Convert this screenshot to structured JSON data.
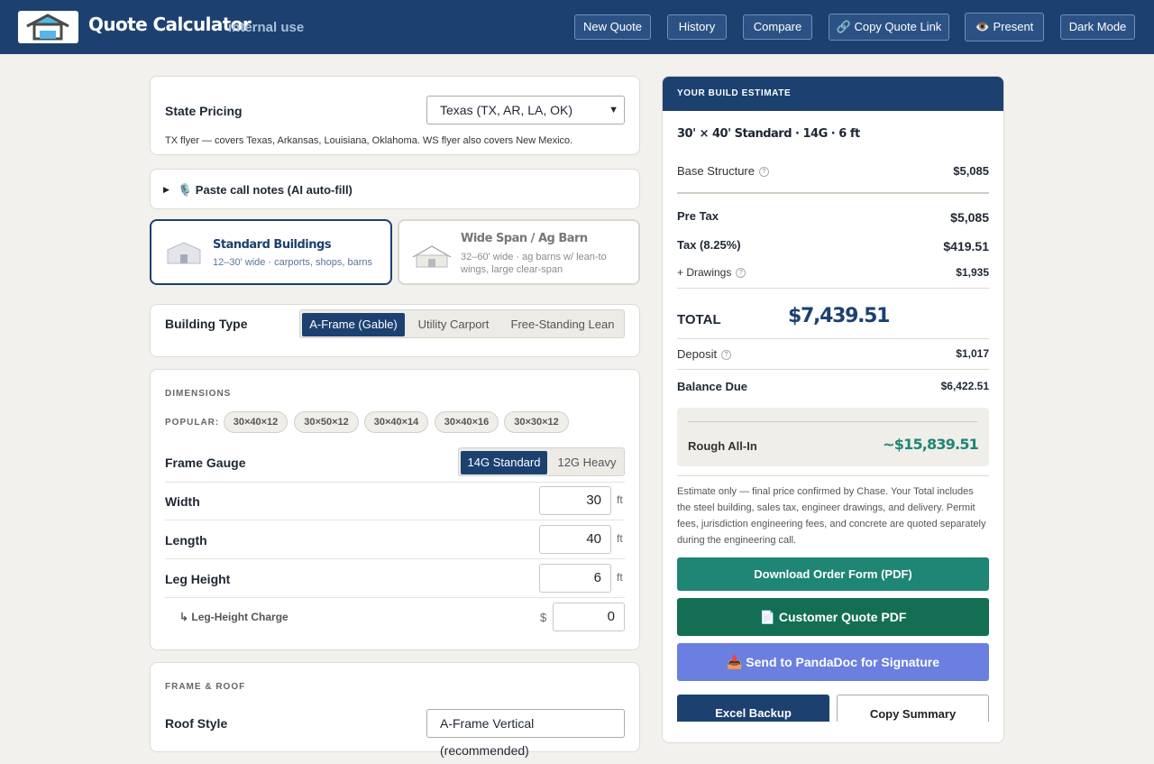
{
  "header": {
    "title": "Quote Calculator",
    "subtitle": "internal use",
    "buttons": {
      "new_quote": "New Quote",
      "history": "History",
      "compare": "Compare",
      "copy_link": "🔗 Copy Quote Link",
      "present": "👁️ Present",
      "dark_mode": "Dark Mode"
    }
  },
  "state_pricing": {
    "label": "State Pricing",
    "selected": "Texas (TX, AR, LA, OK)",
    "note": "TX flyer — covers Texas, Arkansas, Louisiana, Oklahoma. WS flyer also covers New Mexico."
  },
  "call_notes": {
    "label": "🎙️ Paste call notes (AI auto-fill)",
    "arrow": "▶"
  },
  "categories": [
    {
      "title": "Standard Buildings",
      "desc": "12–30' wide · carports, shops, barns",
      "selected": true
    },
    {
      "title": "Wide Span / Ag Barn",
      "desc": "32–60' wide · ag barns w/ lean-to wings, large clear-span",
      "selected": false
    }
  ],
  "building_type": {
    "label": "Building Type",
    "options": [
      "A-Frame (Gable)",
      "Utility Carport",
      "Free-Standing Lean"
    ],
    "selected": "A-Frame (Gable)"
  },
  "dimensions": {
    "section_title": "DIMENSIONS",
    "popular_label": "POPULAR:",
    "popular": [
      "30×40×12",
      "30×50×12",
      "30×40×14",
      "30×40×16",
      "30×30×12"
    ],
    "frame_gauge": {
      "label": "Frame Gauge",
      "options": [
        "14G Standard",
        "12G Heavy"
      ],
      "selected": "14G Standard"
    },
    "width": {
      "label": "Width",
      "value": "30",
      "unit": "ft"
    },
    "length": {
      "label": "Length",
      "value": "40",
      "unit": "ft"
    },
    "leg_height": {
      "label": "Leg Height",
      "value": "6",
      "unit": "ft"
    },
    "leg_charge": {
      "label": "↳ Leg-Height Charge",
      "prefix": "$",
      "value": "0"
    }
  },
  "frame_roof": {
    "section_title": "FRAME & ROOF",
    "roof_style_label": "Roof Style",
    "roof_style_value": "A-Frame Vertical (recommended)"
  },
  "estimate": {
    "header": "YOUR BUILD ESTIMATE",
    "summary": "30' × 40' Standard · 14G · 6 ft",
    "base_label": "Base Structure",
    "base_value": "$5,085",
    "pretax_label": "Pre Tax",
    "pretax_value": "$5,085",
    "tax_label": "Tax (8.25%)",
    "tax_value": "$419.51",
    "drawings_label": "+ Drawings",
    "drawings_value": "$1,935",
    "total_label": "TOTAL",
    "total_value": "$7,439.51",
    "deposit_label": "Deposit",
    "deposit_value": "$1,017",
    "balance_label": "Balance Due",
    "balance_value": "$6,422.51",
    "allin_label": "Rough All-In",
    "allin_value": "~$15,839.51",
    "disclaimer": "Estimate only — final price confirmed by Chase. Your Total includes the steel building, sales tax, engineer drawings, and delivery. Permit fees, jurisdiction engineering fees, and concrete are quoted separately during the engineering call.",
    "info_glyph": "?"
  },
  "actions": {
    "download_order": "Download Order Form (PDF)",
    "customer_pdf": "📄 Customer Quote PDF",
    "pandadoc": "📥 Send to PandaDoc for Signature",
    "excel": "Excel Backup",
    "copy_summary": "Copy Summary"
  },
  "colors": {
    "brand": "#1c4170",
    "teal": "#1f8575",
    "green": "#136e54",
    "indigo": "#6a7fe0",
    "allin": "#1f8575"
  },
  "icons": [
    "logo-house-icon",
    "link-icon",
    "eye-icon",
    "microphone-icon",
    "building-icon",
    "info-icon",
    "document-icon",
    "inbox-icon",
    "select-chevron-icon"
  ]
}
